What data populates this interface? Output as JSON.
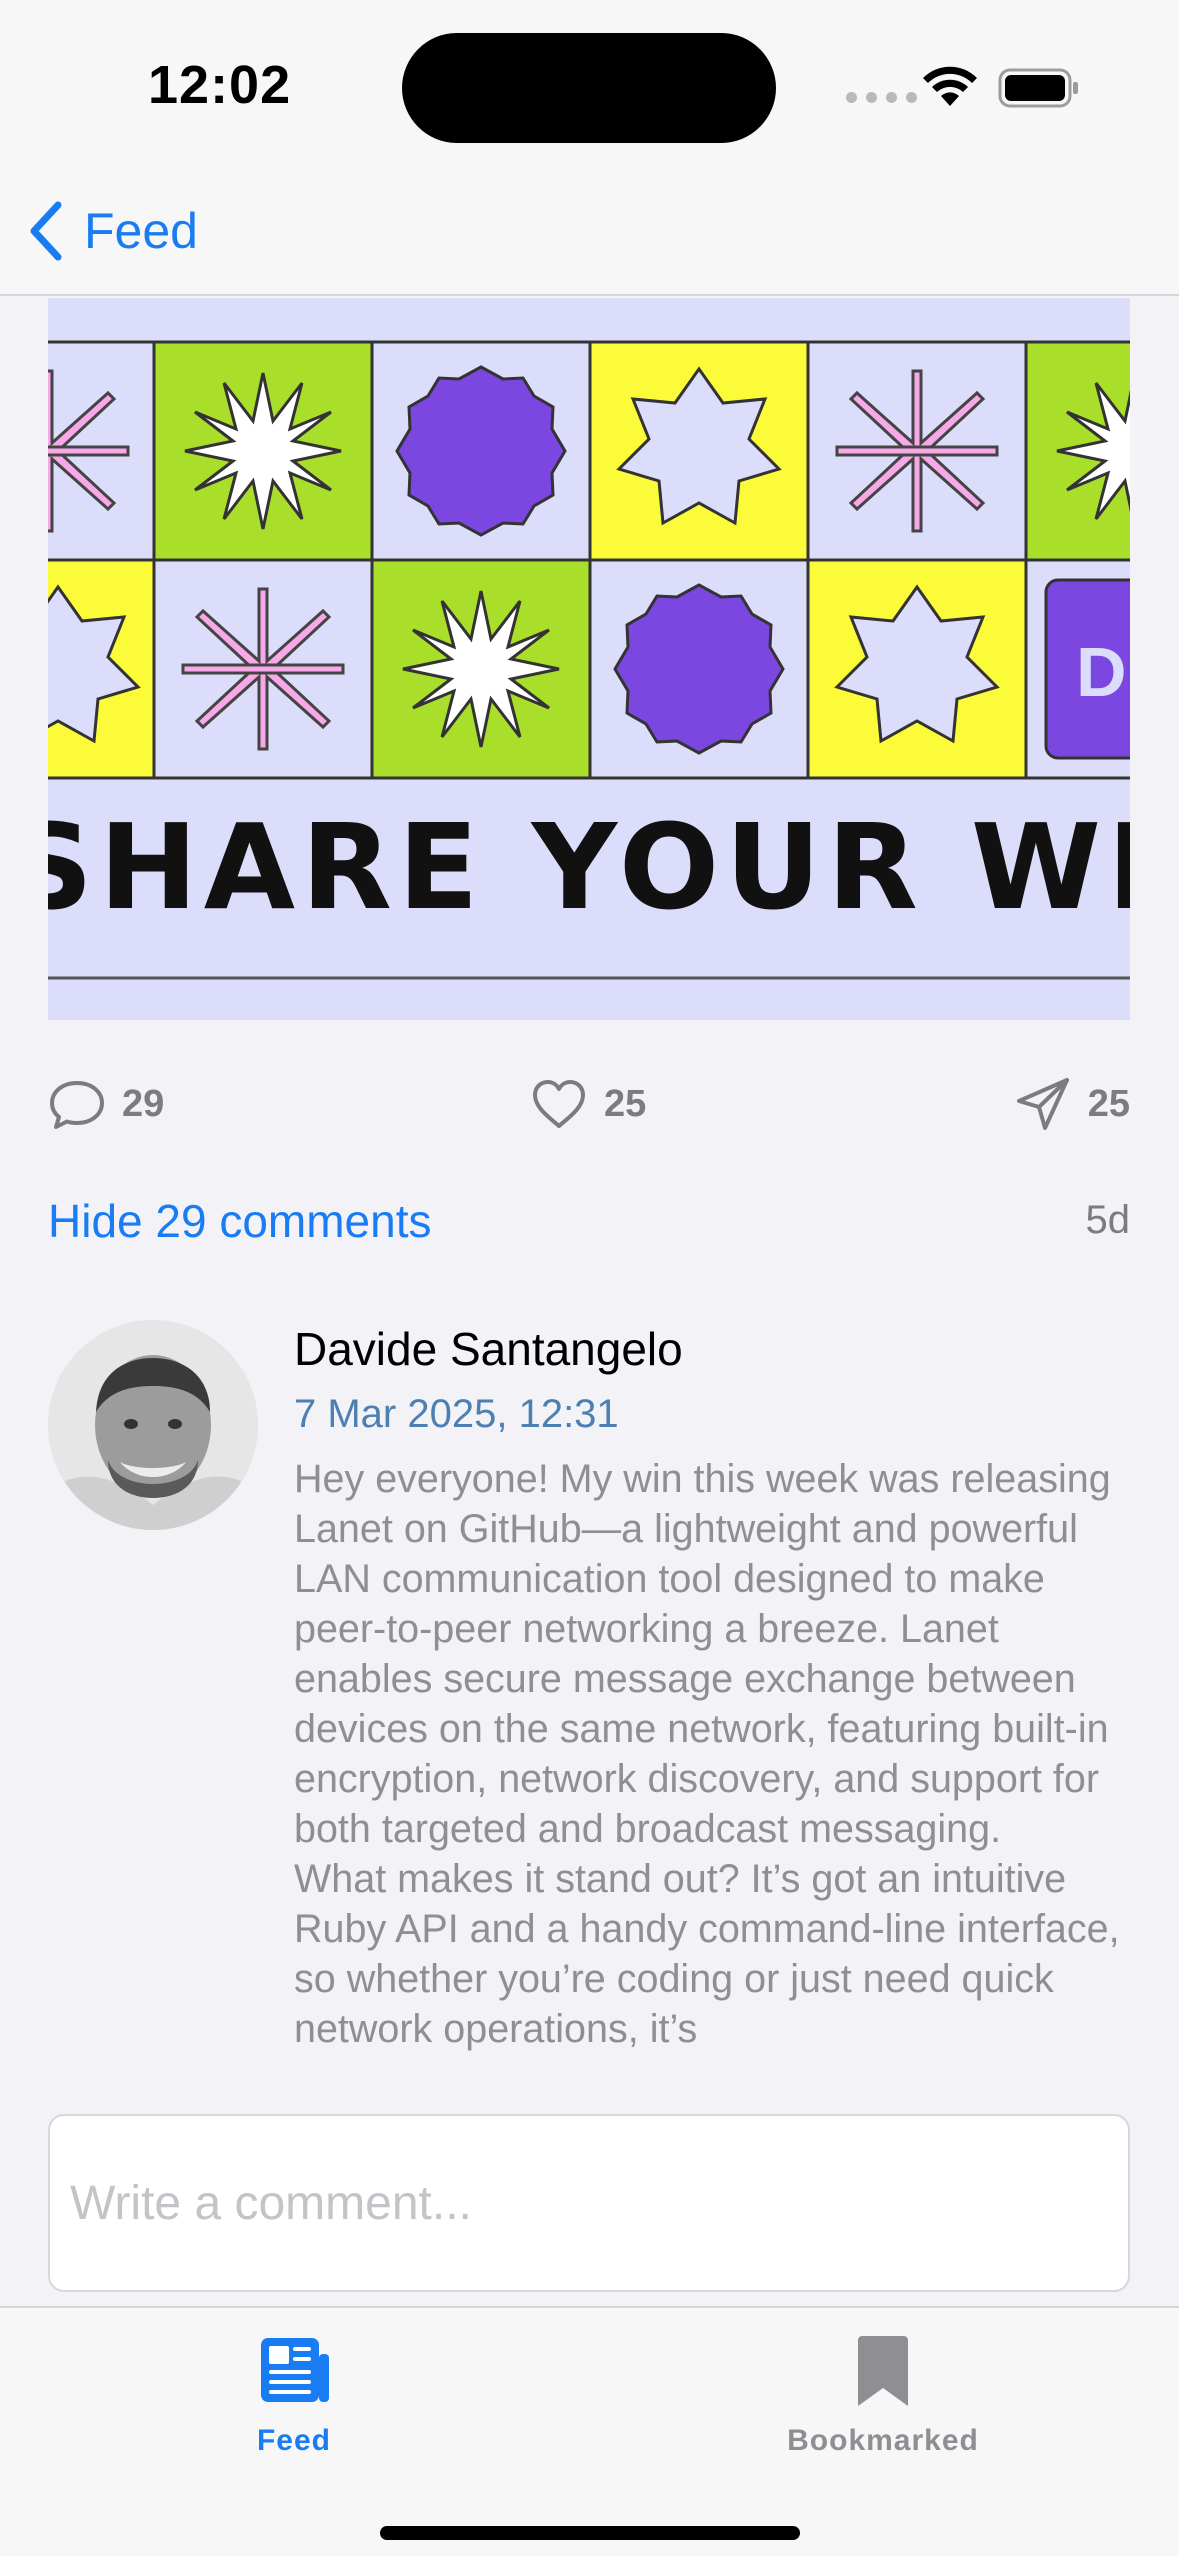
{
  "status_bar": {
    "time": "12:02"
  },
  "nav": {
    "back_label": "Feed"
  },
  "post": {
    "image_text": "SHARE YOUR WINS",
    "image_badge": "DE",
    "comments_count": "29",
    "likes_count": "25",
    "shares_count": "25",
    "hide_comments_label": "Hide 29 comments",
    "age": "5d"
  },
  "comment": {
    "author": "Davide Santangelo",
    "date": "7 Mar 2025, 12:31",
    "paragraph_1": "Hey everyone! My win this week was releasing Lanet on GitHub—a lightweight and powerful LAN communication tool designed to make peer-to-peer networking a breeze. Lanet enables secure message exchange between devices on the same network, featuring built-in encryption, network discovery, and support for both targeted and broadcast messaging.",
    "paragraph_2": "What makes it stand out? It’s got an intuitive Ruby API and a handy command-line interface, so whether you’re coding or just need quick network operations, it’s"
  },
  "composer": {
    "placeholder": "Write a comment..."
  },
  "tab_bar": {
    "tabs": [
      {
        "label": "Feed",
        "icon": "newspaper-icon",
        "selected": true
      },
      {
        "label": "Bookmarked",
        "icon": "bookmark-icon",
        "selected": false
      }
    ]
  },
  "colors": {
    "accent": "#1a7cf3",
    "secondary_text": "#8e8e93",
    "date_text": "#4d7fb3",
    "image_lavender": "#dcdcfb",
    "image_green": "#a9df2a",
    "image_yellow": "#fbfb3a",
    "image_purple": "#7b47e0",
    "image_pink": "#f7a8e8"
  }
}
